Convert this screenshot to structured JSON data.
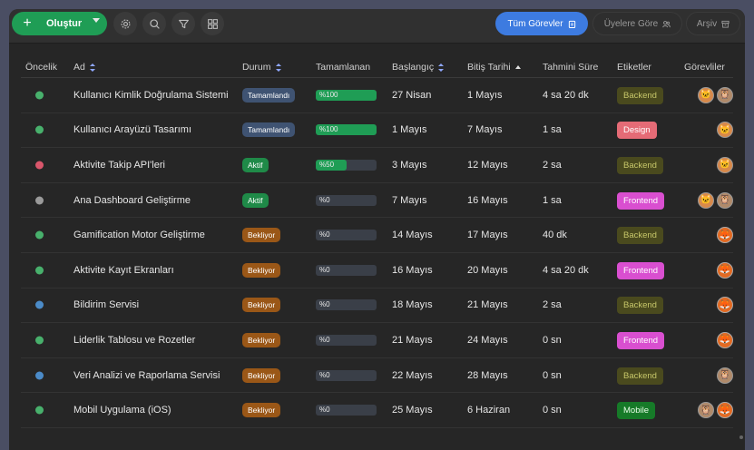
{
  "toolbar": {
    "create_label": "Oluştur",
    "views": [
      {
        "label": "Tüm Görevler",
        "active": true
      },
      {
        "label": "Üyelere Göre",
        "active": false
      },
      {
        "label": "Arşiv",
        "active": false
      }
    ]
  },
  "columns": [
    "Öncelik",
    "Ad",
    "Durum",
    "Tamamlanan",
    "Başlangıç",
    "Bitiş Tarihi",
    "Tahmini Süre",
    "Etiketler",
    "Görevliler"
  ],
  "colors": {
    "priority_green": "#48b06c",
    "priority_red": "#d9566b",
    "priority_gray": "#9a9a9a",
    "priority_blue": "#4b8bc8",
    "status_done": "#3f5372",
    "status_active": "#1f8a48",
    "status_waiting": "#9a5717",
    "progress_fill": "#1f9d55",
    "accent": "#3d7be0"
  },
  "rows": [
    {
      "priority": "priority_green",
      "name": "Kullanıcı Kimlik Doğrulama Sistemi",
      "status": "Tamamlandı",
      "status_type": "done",
      "progress_label": "%100",
      "progress": 100,
      "start": "27 Nisan",
      "end": "1 Mayıs",
      "estimate": "4 sa 20 dk",
      "tag": "Backend",
      "tag_type": "backend",
      "assignees": [
        "cat",
        "owl"
      ]
    },
    {
      "priority": "priority_green",
      "name": "Kullanıcı Arayüzü Tasarımı",
      "status": "Tamamlandı",
      "status_type": "done",
      "progress_label": "%100",
      "progress": 100,
      "start": "1 Mayıs",
      "end": "7 Mayıs",
      "estimate": "1 sa",
      "tag": "Design",
      "tag_type": "design",
      "assignees": [
        "cat"
      ]
    },
    {
      "priority": "priority_red",
      "name": "Aktivite Takip API'leri",
      "status": "Aktif",
      "status_type": "active",
      "progress_label": "%50",
      "progress": 50,
      "start": "3 Mayıs",
      "end": "12 Mayıs",
      "estimate": "2 sa",
      "tag": "Backend",
      "tag_type": "backend",
      "assignees": [
        "cat"
      ]
    },
    {
      "priority": "priority_gray",
      "name": "Ana Dashboard Geliştirme",
      "status": "Aktif",
      "status_type": "active",
      "progress_label": "%0",
      "progress": 0,
      "start": "7 Mayıs",
      "end": "16 Mayıs",
      "estimate": "1 sa",
      "tag": "Frontend",
      "tag_type": "frontend",
      "assignees": [
        "cat",
        "owl"
      ]
    },
    {
      "priority": "priority_green",
      "name": "Gamification Motor Geliştirme",
      "status": "Bekliyor",
      "status_type": "waiting",
      "progress_label": "%0",
      "progress": 0,
      "start": "14 Mayıs",
      "end": "17 Mayıs",
      "estimate": "40 dk",
      "tag": "Backend",
      "tag_type": "backend",
      "assignees": [
        "fox"
      ]
    },
    {
      "priority": "priority_green",
      "name": "Aktivite Kayıt Ekranları",
      "status": "Bekliyor",
      "status_type": "waiting",
      "progress_label": "%0",
      "progress": 0,
      "start": "16 Mayıs",
      "end": "20 Mayıs",
      "estimate": "4 sa 20 dk",
      "tag": "Frontend",
      "tag_type": "frontend",
      "assignees": [
        "fox"
      ]
    },
    {
      "priority": "priority_blue",
      "name": "Bildirim Servisi",
      "status": "Bekliyor",
      "status_type": "waiting",
      "progress_label": "%0",
      "progress": 0,
      "start": "18 Mayıs",
      "end": "21 Mayıs",
      "estimate": "2 sa",
      "tag": "Backend",
      "tag_type": "backend",
      "assignees": [
        "fox"
      ]
    },
    {
      "priority": "priority_green",
      "name": "Liderlik Tablosu ve Rozetler",
      "status": "Bekliyor",
      "status_type": "waiting",
      "progress_label": "%0",
      "progress": 0,
      "start": "21 Mayıs",
      "end": "24 Mayıs",
      "estimate": "0 sn",
      "tag": "Frontend",
      "tag_type": "frontend",
      "assignees": [
        "fox"
      ]
    },
    {
      "priority": "priority_blue",
      "name": "Veri Analizi ve Raporlama Servisi",
      "status": "Bekliyor",
      "status_type": "waiting",
      "progress_label": "%0",
      "progress": 0,
      "start": "22 Mayıs",
      "end": "28 Mayıs",
      "estimate": "0 sn",
      "tag": "Backend",
      "tag_type": "backend",
      "assignees": [
        "owl"
      ]
    },
    {
      "priority": "priority_green",
      "name": "Mobil Uygulama (iOS)",
      "status": "Bekliyor",
      "status_type": "waiting",
      "progress_label": "%0",
      "progress": 0,
      "start": "25 Mayıs",
      "end": "6 Haziran",
      "estimate": "0 sn",
      "tag": "Mobile",
      "tag_type": "mobile",
      "assignees": [
        "owl",
        "fox"
      ]
    }
  ]
}
